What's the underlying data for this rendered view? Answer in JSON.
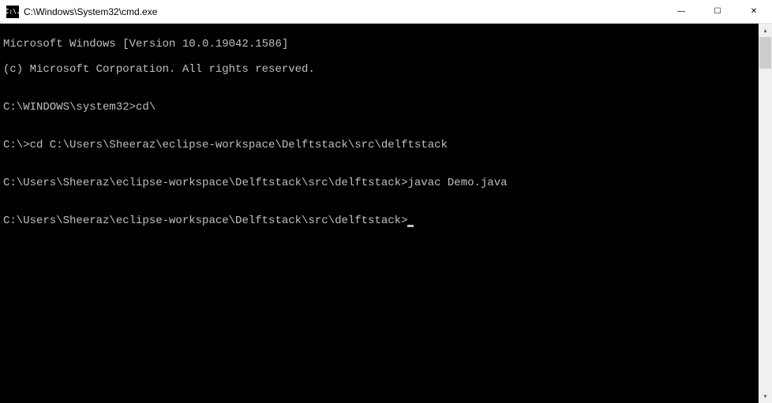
{
  "window": {
    "icon_text": "C:\\.",
    "title": "C:\\Windows\\System32\\cmd.exe"
  },
  "controls": {
    "minimize": "—",
    "maximize": "☐",
    "close": "✕"
  },
  "terminal": {
    "lines": [
      "Microsoft Windows [Version 10.0.19042.1586]",
      "(c) Microsoft Corporation. All rights reserved.",
      "",
      "C:\\WINDOWS\\system32>cd\\",
      "",
      "C:\\>cd C:\\Users\\Sheeraz\\eclipse-workspace\\Delftstack\\src\\delftstack",
      "",
      "C:\\Users\\Sheeraz\\eclipse-workspace\\Delftstack\\src\\delftstack>javac Demo.java",
      "",
      "C:\\Users\\Sheeraz\\eclipse-workspace\\Delftstack\\src\\delftstack>"
    ]
  },
  "scrollbar": {
    "up": "▴",
    "down": "▾"
  }
}
